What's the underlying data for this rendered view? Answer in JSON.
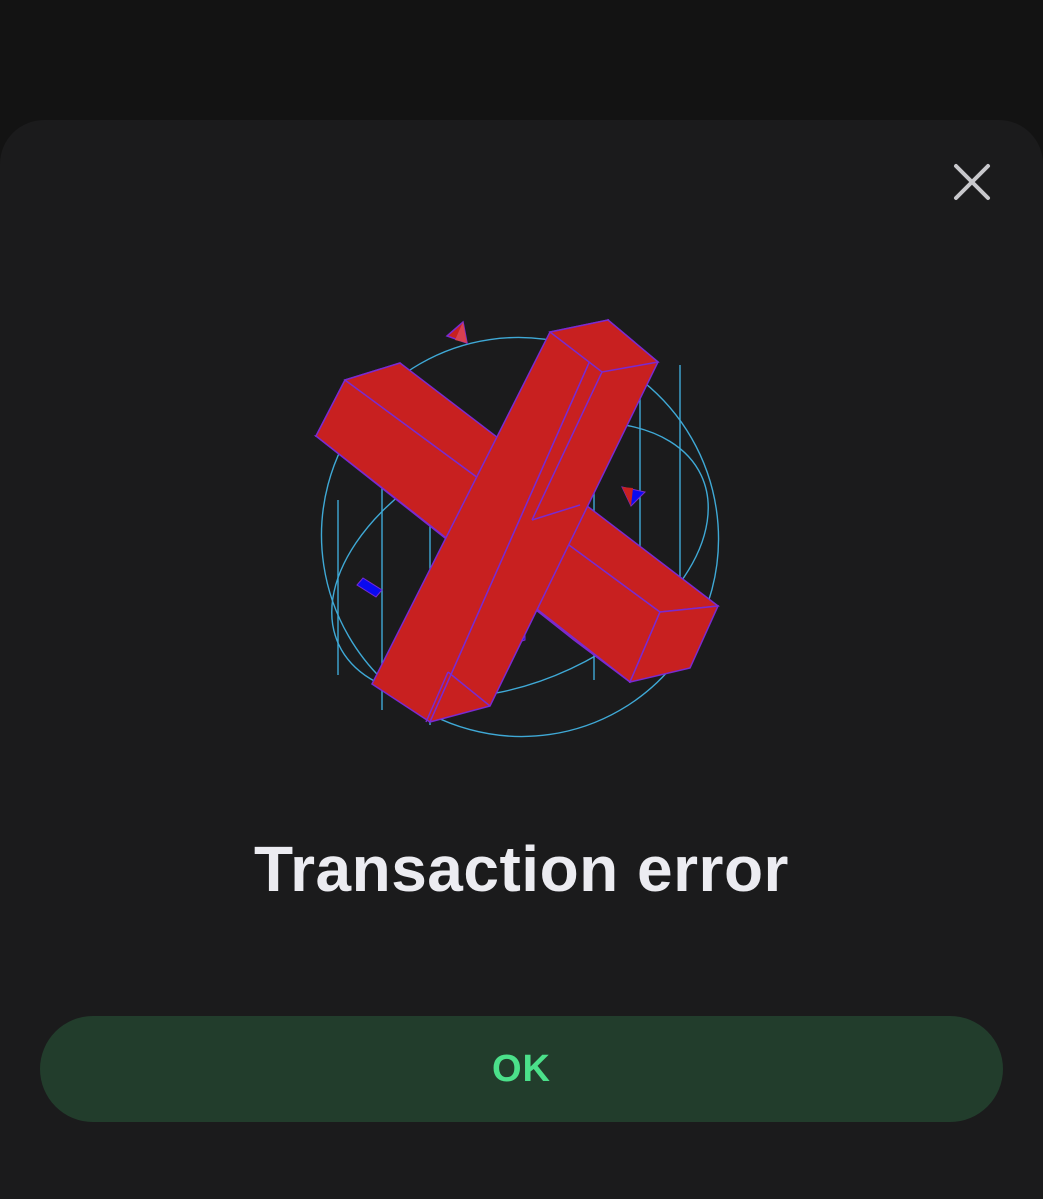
{
  "dialog": {
    "title": "Transaction error",
    "close_icon": "close-icon",
    "illustration_icon": "error-x-3d-icon",
    "ok_label": "OK"
  },
  "colors": {
    "background": "#131313",
    "sheet": "#1b1b1c",
    "title_text": "#ececf1",
    "close_icon": "#c8c8cc",
    "ok_button_bg": "#223d2c",
    "ok_button_text": "#4be08a",
    "x_red": "#c82020",
    "x_blue": "#0a0af0",
    "orbit_line": "#3fa9d6"
  }
}
